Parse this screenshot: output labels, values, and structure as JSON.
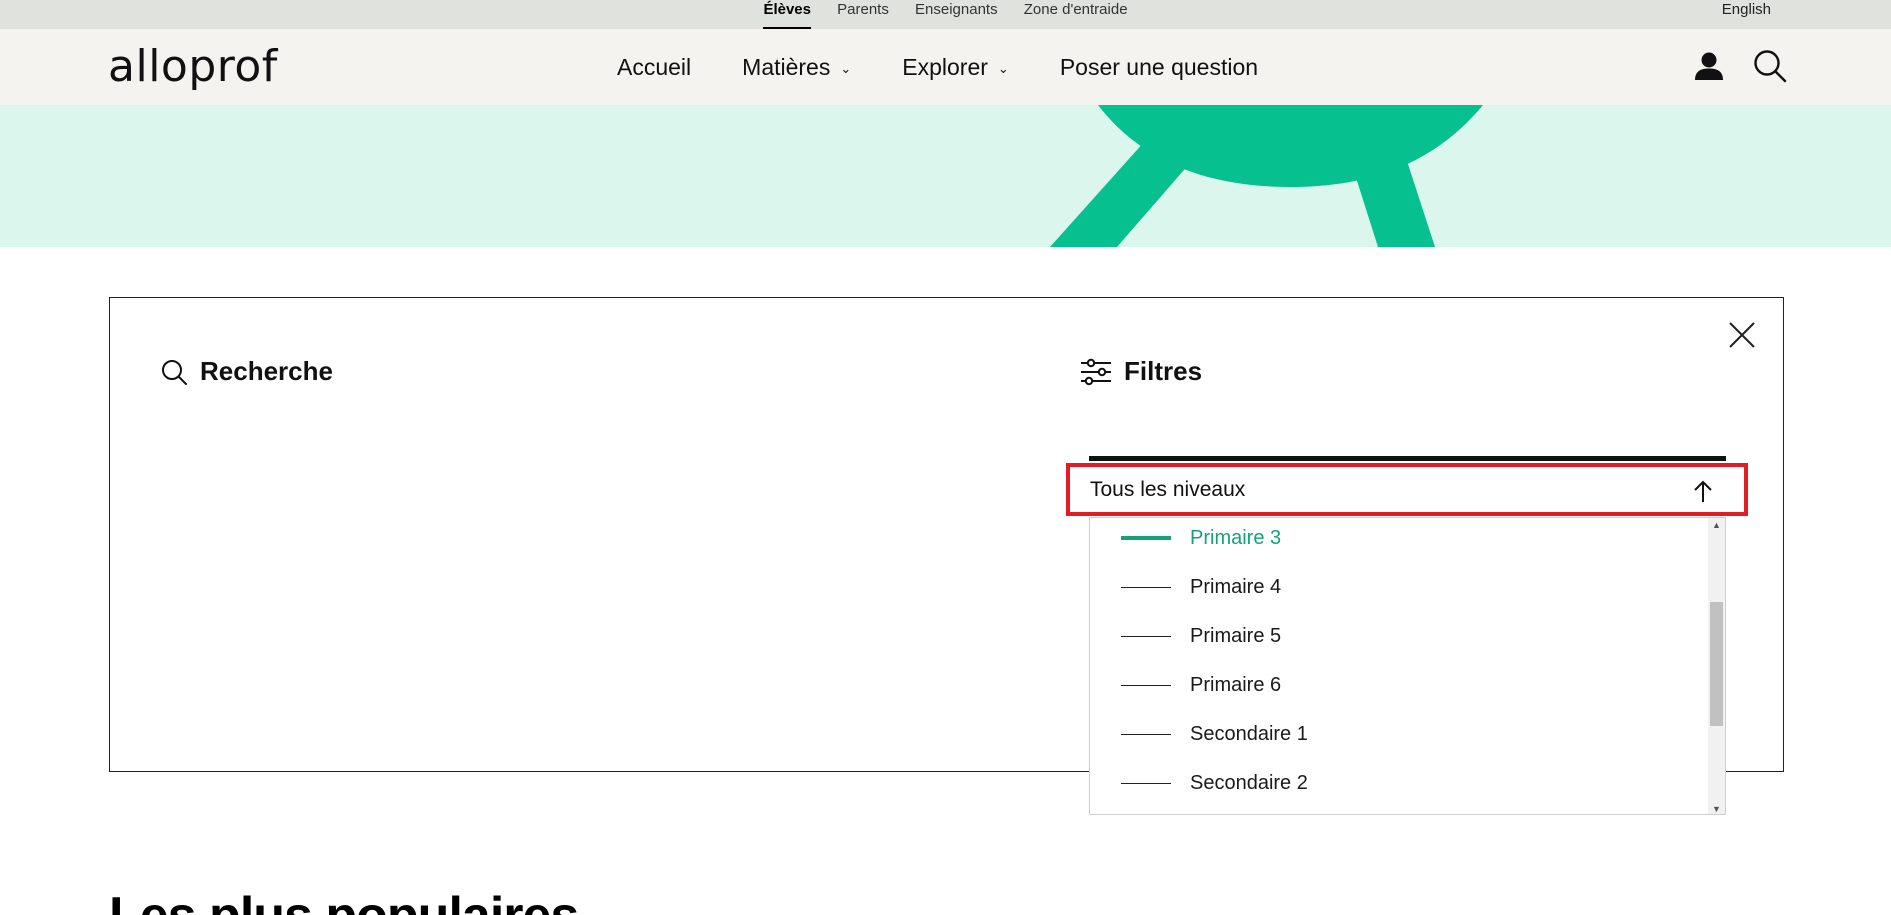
{
  "audience_bar": {
    "links": [
      "Élèves",
      "Parents",
      "Enseignants",
      "Zone d'entraide"
    ],
    "language": "English"
  },
  "header": {
    "logo": "alloprof",
    "nav": [
      {
        "label": "Accueil",
        "has_dropdown": false
      },
      {
        "label": "Matières",
        "has_dropdown": true
      },
      {
        "label": "Explorer",
        "has_dropdown": true
      },
      {
        "label": "Poser une question",
        "has_dropdown": false
      }
    ],
    "icons": [
      "user-icon",
      "search-icon"
    ]
  },
  "colors": {
    "accent_green": "#06c08f",
    "hero_bg": "#dbf6ec",
    "highlight_red": "#e31b23",
    "selected_text": "#15a27a"
  },
  "panel": {
    "search_title": "Recherche",
    "filter_title": "Filtres",
    "level_select": {
      "value": "Tous les niveaux",
      "options": [
        {
          "label": "Primaire 3",
          "selected": true
        },
        {
          "label": "Primaire 4",
          "selected": false
        },
        {
          "label": "Primaire 5",
          "selected": false
        },
        {
          "label": "Primaire 6",
          "selected": false
        },
        {
          "label": "Secondaire 1",
          "selected": false
        },
        {
          "label": "Secondaire 2",
          "selected": false
        }
      ]
    }
  },
  "popular": {
    "heading": "Les plus populaires"
  }
}
